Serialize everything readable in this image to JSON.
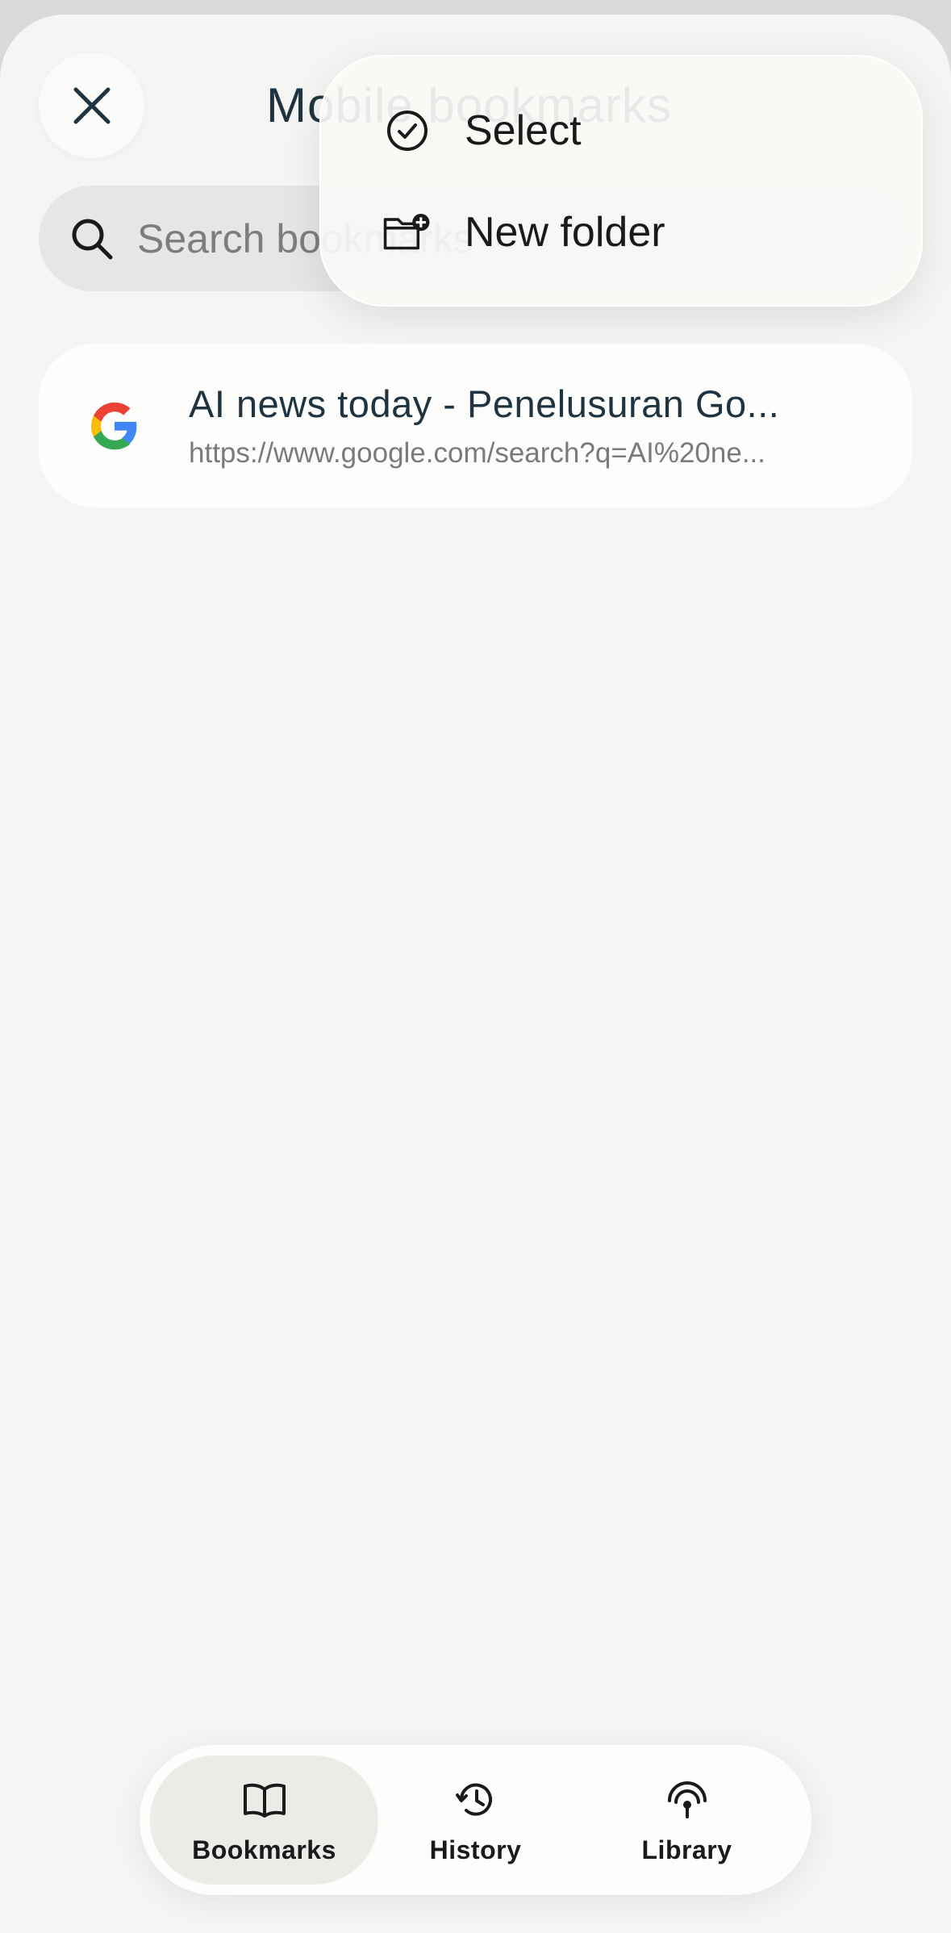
{
  "header": {
    "title": "Mobile bookmarks",
    "close_icon": "close-icon"
  },
  "search": {
    "placeholder": "Search bookmarks",
    "icon": "search-icon"
  },
  "bookmarks": [
    {
      "title": "AI news today - Penelusuran Go...",
      "url": "https://www.google.com/search?q=AI%20ne...",
      "favicon": "google-favicon"
    }
  ],
  "menu": {
    "items": [
      {
        "label": "Select",
        "icon": "check-circle-icon"
      },
      {
        "label": "New folder",
        "icon": "new-folder-icon"
      }
    ]
  },
  "bottom_nav": {
    "items": [
      {
        "label": "Bookmarks",
        "icon": "book-icon",
        "active": true
      },
      {
        "label": "History",
        "icon": "history-icon",
        "active": false
      },
      {
        "label": "Library",
        "icon": "library-icon",
        "active": false
      }
    ]
  },
  "colors": {
    "background": "#f5f5f3",
    "title_text": "#1f3440",
    "url_text": "#7a7a7a"
  }
}
